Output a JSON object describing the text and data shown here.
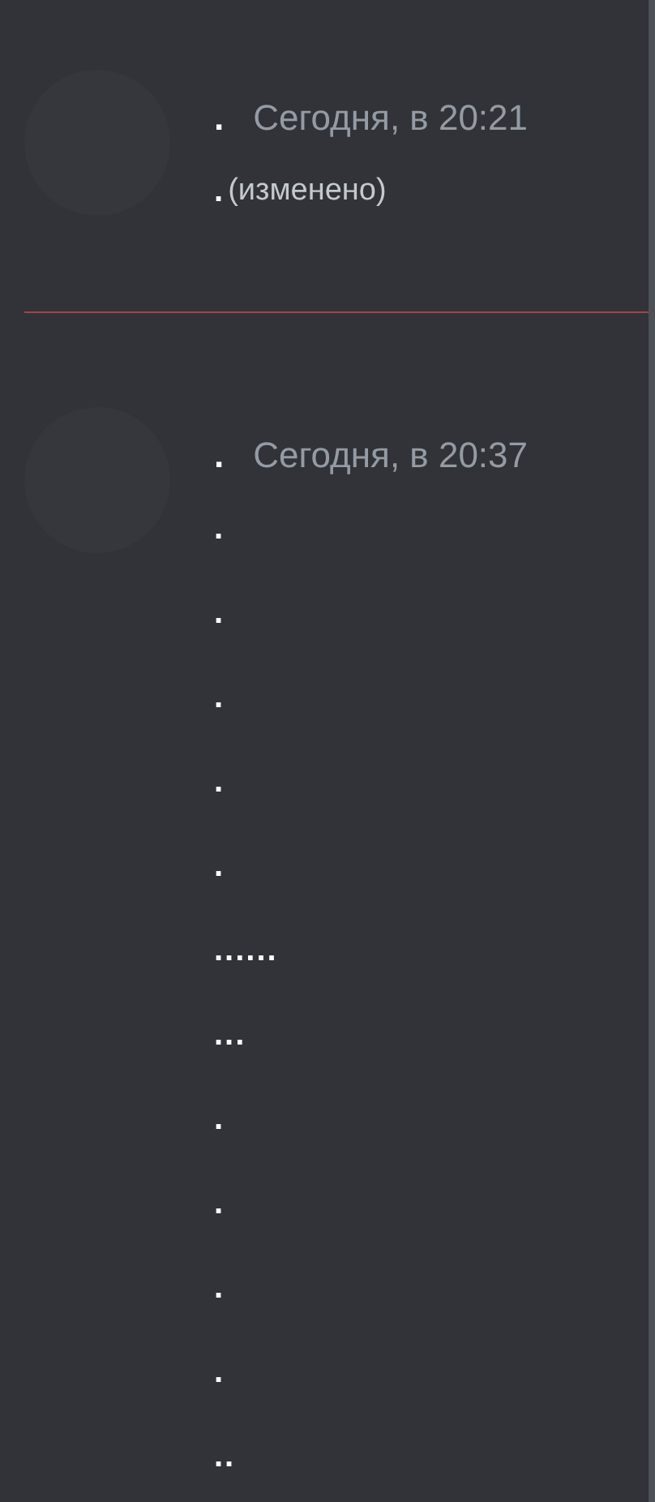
{
  "messages": [
    {
      "author": ".",
      "timestamp": "Сегодня, в 20:21",
      "lines": [
        {
          "text": ".",
          "edited_label": "(изменено)"
        }
      ]
    },
    {
      "author": ".",
      "timestamp": "Сегодня, в 20:37",
      "lines": [
        {
          "text": "."
        },
        {
          "text": "."
        },
        {
          "text": "."
        },
        {
          "text": "."
        },
        {
          "text": "."
        },
        {
          "text": "......"
        },
        {
          "text": "..."
        },
        {
          "text": "."
        },
        {
          "text": "."
        },
        {
          "text": "."
        },
        {
          "text": "."
        },
        {
          "text": ".."
        }
      ]
    }
  ]
}
